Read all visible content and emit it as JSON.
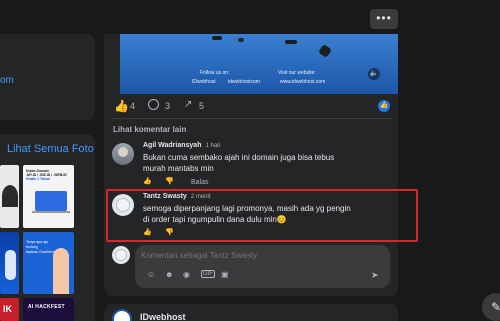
{
  "sidebar": {
    "link_fragment": "om",
    "see_all_photos": "Lihat Semua Foto"
  },
  "toolbar": {
    "more_label": "•••"
  },
  "post": {
    "banner": {
      "follow_label": "Follow us on:",
      "follow_handle": "IDwebhost",
      "visit_label": "Visit our website:",
      "visit_url": "www.idwebhost.com",
      "handle_2": "idwebhostcom"
    },
    "reactions": {
      "like_count": "4",
      "comment_count": "3",
      "share_count": "5"
    },
    "view_more_comments": "Lihat komentar lain"
  },
  "comments": [
    {
      "author": "Agil Wadriansyah",
      "time": "1 hari",
      "text_line_1": "Bukan cuma sembako ajah ini domain juga bisa tebus",
      "text_line_2": "murah mantabs min",
      "reply_label": "Balas"
    },
    {
      "author": "Tantz Swasty",
      "time": "2 menit",
      "text_line_1": "semoga diperpanjang lagi promonya, masih ada yg pengin",
      "text_line_2": "di order tapi ngumpulin dana dulu min😊"
    }
  ],
  "comment_input": {
    "placeholder": "Komentari sebagai Tantz Swasty"
  },
  "next_post": {
    "page_name": "IDwebhost"
  },
  "colors": {
    "background": "#18191a",
    "card": "#242526",
    "accent": "#4599ff",
    "highlight": "#e0222a"
  },
  "photos": {
    "photo_1": "",
    "photo_2_line_1": "Klaim Domain",
    "photo_2_line_2": ".MY.ID / .BIZ.ID / .WEB.ID",
    "photo_2_line_3": "Gratis 1 Tahun",
    "photo_4_line_1": "Tanya apa aja",
    "photo_4_line_2": "tentang",
    "photo_4_line_3": "layanan IDwebhost",
    "photo_6": "AI HACKFEST",
    "photo_5": "IK"
  }
}
